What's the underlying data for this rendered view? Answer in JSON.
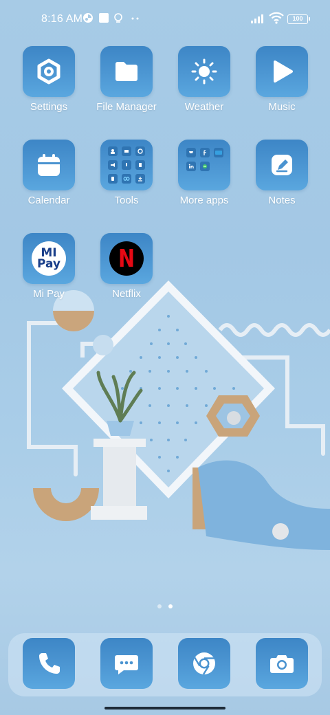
{
  "status_bar": {
    "time": "8:16 AM",
    "battery": "100",
    "icons": [
      "app-notification-icon",
      "square-notification-icon",
      "bulb-notification-icon",
      "more-dots-icon",
      "signal-icon",
      "wifi-icon",
      "battery-icon"
    ]
  },
  "apps": {
    "settings": "Settings",
    "file_manager": "File Manager",
    "weather": "Weather",
    "music": "Music",
    "calendar": "Calendar",
    "tools": "Tools",
    "more_apps": "More apps",
    "notes": "Notes",
    "mi_pay": "Mi Pay",
    "netflix": "Netflix"
  },
  "mipay_logo": "MI Pay",
  "netflix_logo": "N",
  "dock": [
    "phone",
    "messages",
    "chrome",
    "camera"
  ],
  "pages": {
    "count": 2,
    "current": 2
  },
  "colors": {
    "tile": "#4a93d0",
    "background": "#a7cbe6",
    "netflix_red": "#e50914"
  }
}
